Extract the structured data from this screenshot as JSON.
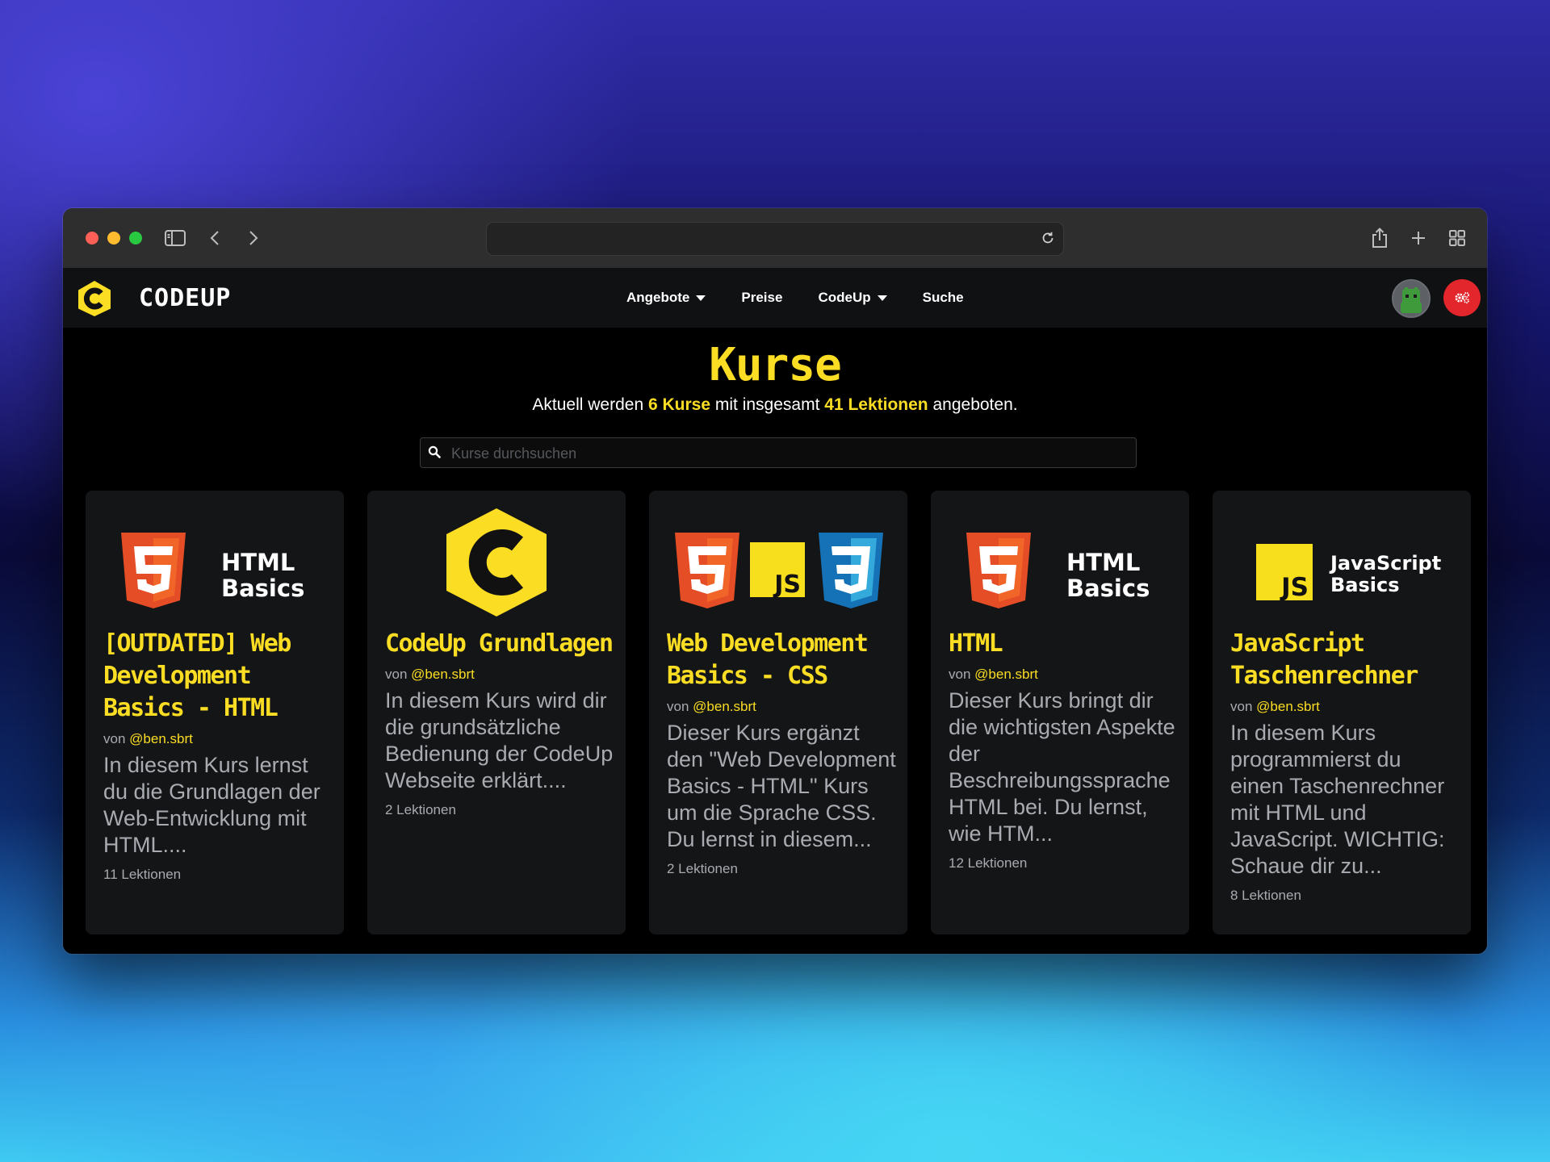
{
  "site": {
    "brand": "CODEUP",
    "nav": [
      {
        "label": "Angebote",
        "dropdown": true
      },
      {
        "label": "Preise",
        "dropdown": false
      },
      {
        "label": "CodeUp",
        "dropdown": true
      },
      {
        "label": "Suche",
        "dropdown": false
      }
    ]
  },
  "colors": {
    "accent": "#fbdd23",
    "admin": "#e3262b",
    "card_bg": "#141517"
  },
  "page": {
    "title": "Kurse",
    "subtitle_prefix": "Aktuell werden",
    "course_count": "6 Kurse",
    "subtitle_middle": "mit insgesamt",
    "lesson_count": "41 Lektionen",
    "subtitle_suffix": "angeboten."
  },
  "search": {
    "placeholder": "Kurse durchsuchen",
    "value": ""
  },
  "courses": [
    {
      "title": "[OUTDATED] Web Development Basics - HTML",
      "author_prefix": "von",
      "author": "@ben.sbrt",
      "description": "In diesem Kurs lernst du die Grundlagen der Web-Entwicklung mit HTML....",
      "lessons": "11 Lektionen",
      "thumb_text": [
        "HTML",
        "Basics"
      ]
    },
    {
      "title": "CodeUp Grundlagen",
      "author_prefix": "von",
      "author": "@ben.sbrt",
      "description": "In diesem Kurs wird dir die grundsätzliche Bedienung der CodeUp Webseite erklärt....",
      "lessons": "2 Lektionen",
      "thumb_text": []
    },
    {
      "title": "Web Development Basics - CSS",
      "author_prefix": "von",
      "author": "@ben.sbrt",
      "description": "Dieser Kurs ergänzt den \"Web Development Basics - HTML\" Kurs um die Sprache CSS. Du lernst in diesem...",
      "lessons": "2 Lektionen",
      "thumb_text": [
        "JS"
      ]
    },
    {
      "title": "HTML",
      "author_prefix": "von",
      "author": "@ben.sbrt",
      "description": "Dieser Kurs bringt dir die wichtigsten Aspekte der Beschreibungssprache HTML bei. Du lernst, wie HTM...",
      "lessons": "12 Lektionen",
      "thumb_text": [
        "HTML",
        "Basics"
      ]
    },
    {
      "title": "JavaScript Taschenrechner",
      "author_prefix": "von",
      "author": "@ben.sbrt",
      "description": "In diesem Kurs programmierst du einen Taschenrechner mit HTML und JavaScript. WICHTIG: Schaue dir zu...",
      "lessons": "8 Lektionen",
      "thumb_text": [
        "JS",
        "JavaScript",
        "Basics"
      ]
    }
  ]
}
